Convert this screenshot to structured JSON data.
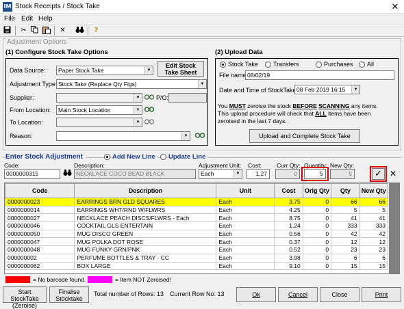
{
  "window": {
    "title": "Stock Receipts / Stock Take",
    "app_icon": "IM",
    "close": "✕"
  },
  "menu": [
    "File",
    "Edit",
    "Help"
  ],
  "toolbar": [
    "save-icon",
    "cut-icon",
    "copy-icon",
    "paste-icon",
    "delete-icon",
    "find-icon",
    "help-icon"
  ],
  "adjustment_options": {
    "title": "Adjustment Options",
    "configure": {
      "heading": "(1) Configure Stock Take Options",
      "data_source_label": "Data Source:",
      "data_source_value": "Paper Stock Take",
      "edit_sheet_button": "Edit Stock Take Sheet",
      "adjustment_type_label": "Adjustment Type:",
      "adjustment_type_value": "Stock Take (Replace Qty Figs)",
      "supplier_label": "Supplier:",
      "po_label": "P/O:",
      "from_location_label": "From Location:",
      "from_location_value": "Main Stock Location",
      "to_location_label": "To  Location:",
      "reason_label": "Reason:"
    },
    "upload": {
      "heading": "(2) Upload Data",
      "radios": [
        "Stock Take",
        "Transfers",
        "Purchases",
        "All"
      ],
      "selected_radio": 0,
      "file_name_label": "File name:",
      "file_name_value": "08/02/19",
      "datetime_label": "Date and Time of StockTake:",
      "datetime_value": "08 Feb 2019 16:15",
      "msg_part1": "You ",
      "msg_must": "MUST",
      "msg_part2": " zeroise the stock ",
      "msg_before": "BEFORE",
      "msg_scanning": "SCANNING",
      "msg_part3": " any items.",
      "msg_line2a": "This upload procedure will check that ",
      "msg_all": "ALL",
      "msg_line2b": " items have been",
      "msg_line3": "zeroised in the last   7 days.",
      "upload_button": "Upload and Complete Stock Take"
    }
  },
  "entry": {
    "heading": "Enter Stock Adjustment",
    "radio_add": "Add New Line",
    "radio_update": "Update Line",
    "code_label": "Code:",
    "code_value": "0000000315",
    "description_label": "Description:",
    "description_value": "NECKLACE COCO BEAD BLACK",
    "adj_unit_label": "Adjustment Unit:",
    "adj_unit_value": "Each",
    "cost_label": "Cost:",
    "cost_value": "1.27",
    "curr_qty_label": "Curr Qty:",
    "curr_qty_value": "0",
    "quantity_label": "Quantity:",
    "quantity_value": "5",
    "new_qty_label": "New Qty:",
    "new_qty_value": "5",
    "accept": "✓",
    "cancel": "✕"
  },
  "grid": {
    "columns": [
      "Code",
      "Description",
      "Unit",
      "Cost",
      "Orig Qty",
      "Qty",
      "New Qty"
    ],
    "rows": [
      [
        "0000000023",
        "EARRINGS BRN GLD SQUARES",
        "Each",
        "3.75",
        "0",
        "66",
        "66"
      ],
      [
        "0000000014",
        "EARRINGS WHT/RND W/FLWRS",
        "Each",
        "4.25",
        "0",
        "5",
        "5"
      ],
      [
        "0000000027",
        "NECKLACE PEACH DISCS/FLWRS - Each",
        "Each",
        "8.75",
        "0",
        "41",
        "41"
      ],
      [
        "0000000046",
        "COCKTAIL GLS ENTERTAIN",
        "Each",
        "1.24",
        "0",
        "333",
        "333"
      ],
      [
        "0000000050",
        "MUG DISCO GREEN",
        "Each",
        "0.56",
        "0",
        "42",
        "42"
      ],
      [
        "0000000047",
        "MUG POLKA DOT ROSE",
        "Each",
        "0.37",
        "0",
        "12",
        "12"
      ],
      [
        "0000000048",
        "MUG FUNKY GRN/PNK",
        "Each",
        "0.52",
        "0",
        "23",
        "23"
      ],
      [
        "000000002",
        "PERFUME BOTTLES & TRAY - CC",
        "Each",
        "3.98",
        "0",
        "6",
        "6"
      ],
      [
        "0000000062",
        "BOX LARGE",
        "Each",
        "9.10",
        "0",
        "15",
        "15"
      ]
    ],
    "highlight_row": 0
  },
  "legend": {
    "red_color": "#ff0000",
    "red_label": "= No barcode found.",
    "magenta_color": "#ff00ff",
    "magenta_label": "= Item NOT Zeroised!"
  },
  "footer": {
    "start_button": "Start StockTake (Zeroise)",
    "finalise_button": "Finalise Stocktake",
    "total_rows": "Total number of Rows: 13",
    "current_row": "Current Row No: 13",
    "ok": "Ok",
    "cancel": "Cancel",
    "close": "Close",
    "print": "Print"
  }
}
